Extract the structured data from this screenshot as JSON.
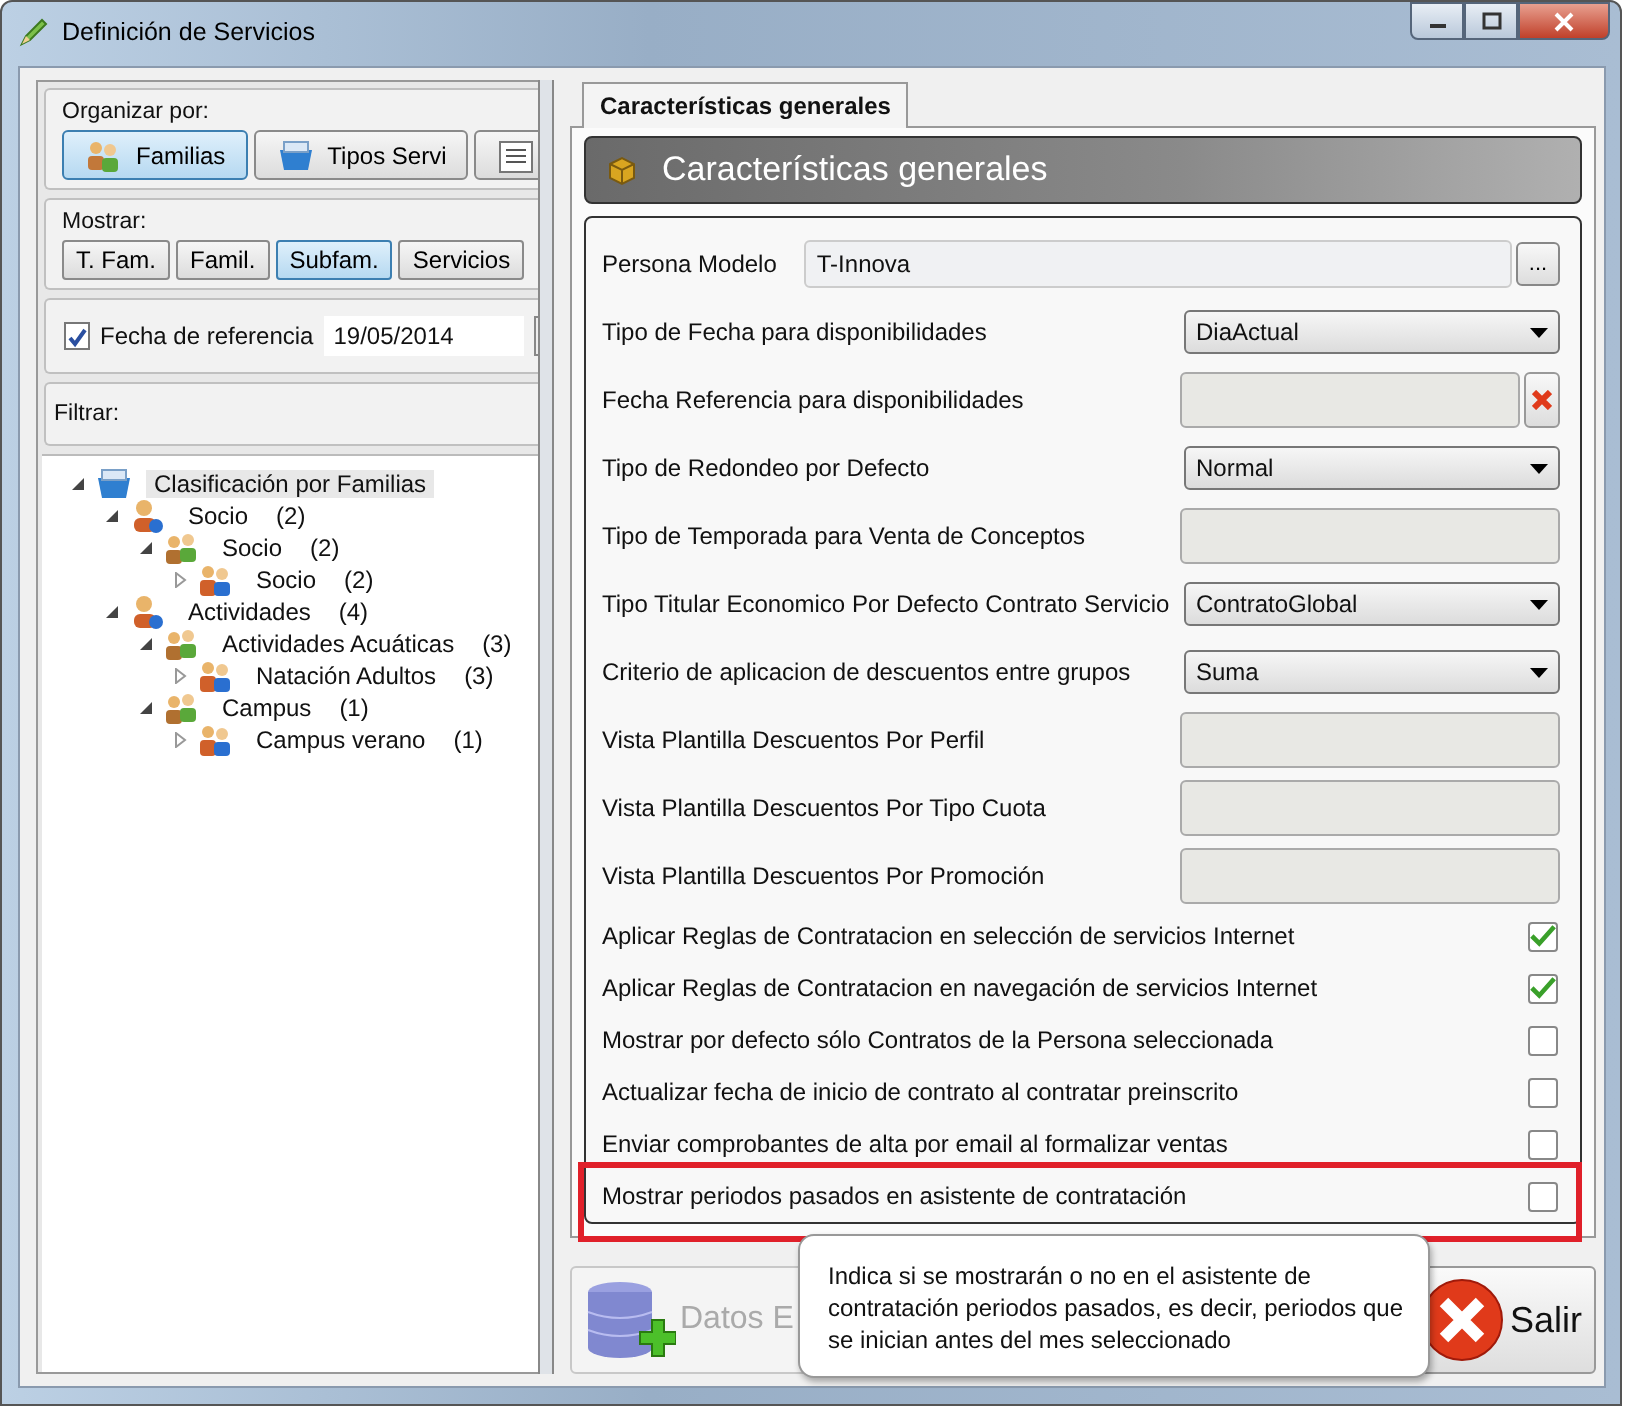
{
  "window": {
    "title": "Definición de Servicios"
  },
  "organize": {
    "label": "Organizar por:",
    "options": [
      {
        "label": "Familias",
        "kind": "families",
        "selected": true
      },
      {
        "label": "Tipos Servi",
        "kind": "types",
        "selected": false
      },
      {
        "kind": "list",
        "selected": false
      }
    ]
  },
  "show": {
    "label": "Mostrar:",
    "options": [
      {
        "label": "T. Fam.",
        "selected": false
      },
      {
        "label": "Famil.",
        "selected": false
      },
      {
        "label": "Subfam.",
        "selected": true
      },
      {
        "label": "Servicios",
        "selected": false
      }
    ]
  },
  "reference_date": {
    "label": "Fecha de referencia",
    "checked": true,
    "value": "19/05/2014"
  },
  "filter": {
    "label": "Filtrar:"
  },
  "tree": [
    {
      "label": "Clasificación por Familias",
      "kind": "root",
      "expanded": true,
      "selected": true,
      "children": [
        {
          "label": "Socio",
          "count": "(2)",
          "kind": "person",
          "expanded": true,
          "selected": false,
          "children": [
            {
              "label": "Socio",
              "count": "(2)",
              "kind": "group",
              "expanded": true,
              "selected": false,
              "children": [
                {
                  "label": "Socio",
                  "count": "(2)",
                  "kind": "team",
                  "expanded": false,
                  "selected": false
                }
              ]
            }
          ]
        },
        {
          "label": "Actividades",
          "count": "(4)",
          "kind": "person",
          "expanded": true,
          "selected": false,
          "children": [
            {
              "label": "Actividades Acuáticas",
              "count": "(3)",
              "kind": "group",
              "expanded": true,
              "selected": false,
              "children": [
                {
                  "label": "Natación Adultos",
                  "count": "(3)",
                  "kind": "team",
                  "expanded": false,
                  "selected": false
                }
              ]
            },
            {
              "label": "Campus",
              "count": "(1)",
              "kind": "group",
              "expanded": true,
              "selected": false,
              "children": [
                {
                  "label": "Campus verano",
                  "count": "(1)",
                  "kind": "team",
                  "expanded": false,
                  "selected": false
                }
              ]
            }
          ]
        }
      ]
    }
  ],
  "tab": {
    "label": "Características generales"
  },
  "section_title": "Características generales",
  "fields": [
    {
      "kind": "lookup",
      "label": "Persona Modelo",
      "value": "T-Innova",
      "button": "..."
    },
    {
      "kind": "dropdown",
      "label": "Tipo de Fecha para disponibilidades",
      "value": "DiaActual"
    },
    {
      "kind": "clearable",
      "label": "Fecha Referencia para disponibilidades"
    },
    {
      "kind": "dropdown",
      "label": "Tipo de Redondeo por Defecto",
      "value": "Normal"
    },
    {
      "kind": "empty",
      "label": "Tipo de Temporada para Venta de Conceptos"
    },
    {
      "kind": "dropdown",
      "label": "Tipo Titular Economico Por Defecto Contrato Servicio",
      "value": "ContratoGlobal"
    },
    {
      "kind": "dropdown",
      "label": "Criterio de aplicacion de descuentos entre grupos",
      "value": "Suma"
    },
    {
      "kind": "empty",
      "label": "Vista Plantilla Descuentos Por Perfil"
    },
    {
      "kind": "empty",
      "label": "Vista Plantilla Descuentos Por Tipo Cuota"
    },
    {
      "kind": "empty",
      "label": "Vista Plantilla Descuentos Por Promoción"
    },
    {
      "kind": "checkbox",
      "label": "Aplicar Reglas de Contratacion en selección de servicios Internet",
      "checked": true
    },
    {
      "kind": "checkbox",
      "label": "Aplicar Reglas de Contratacion en navegación de servicios Internet",
      "checked": true
    },
    {
      "kind": "checkbox",
      "label": "Mostrar por defecto sólo Contratos de la Persona seleccionada",
      "checked": false
    },
    {
      "kind": "checkbox",
      "label": "Actualizar fecha de inicio de contrato al contratar preinscrito",
      "checked": false
    },
    {
      "kind": "checkbox",
      "label": "Enviar comprobantes de alta por email al formalizar ventas",
      "checked": false
    },
    {
      "kind": "checkbox",
      "label": "Mostrar periodos pasados en asistente de contratación",
      "checked": false,
      "highlighted": true
    }
  ],
  "buttons": [
    {
      "kind": "extra",
      "label": "Datos E",
      "disabled": true
    },
    {
      "kind": "exit",
      "label": "Salir",
      "disabled": false
    }
  ],
  "tooltip": "Indica si se mostrarán o no en el asistente de contratación periodos pasados, es decir, periodos que se inician antes del mes seleccionado"
}
